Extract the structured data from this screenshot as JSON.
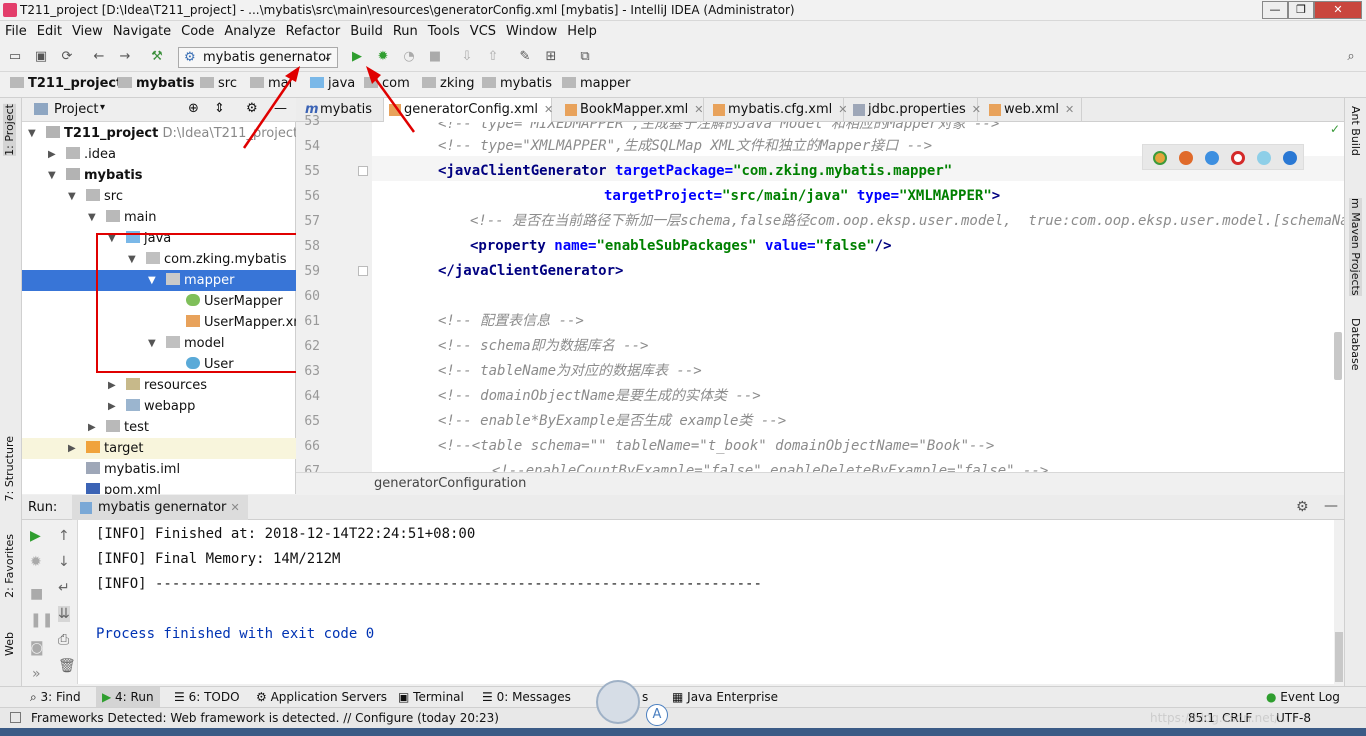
{
  "window": {
    "title": "T211_project [D:\\Idea\\T211_project] - ...\\mybatis\\src\\main\\resources\\generatorConfig.xml [mybatis] - IntelliJ IDEA (Administrator)"
  },
  "menu": [
    "File",
    "Edit",
    "View",
    "Navigate",
    "Code",
    "Analyze",
    "Refactor",
    "Build",
    "Run",
    "Tools",
    "VCS",
    "Window",
    "Help"
  ],
  "toolbar": {
    "run_config": "mybatis genernator"
  },
  "breadcrumbs": [
    "T211_project",
    "mybatis",
    "src",
    "main",
    "java",
    "com",
    "zking",
    "mybatis",
    "mapper"
  ],
  "project_panel": {
    "title": "Project"
  },
  "tree": [
    {
      "label": "T211_project",
      "path": "D:\\Idea\\T211_project",
      "icon": "module-folder-icon"
    },
    {
      "label": ".idea",
      "icon": "folder-icon"
    },
    {
      "label": "mybatis",
      "icon": "module-folder-icon"
    },
    {
      "label": "src",
      "icon": "folder-icon"
    },
    {
      "label": "main",
      "icon": "folder-icon"
    },
    {
      "label": "java",
      "icon": "source-folder-icon"
    },
    {
      "label": "com.zking.mybatis",
      "icon": "package-icon"
    },
    {
      "label": "mapper",
      "icon": "package-icon"
    },
    {
      "label": "UserMapper",
      "icon": "interface-icon"
    },
    {
      "label": "UserMapper.xm",
      "icon": "xml-file-icon"
    },
    {
      "label": "model",
      "icon": "package-icon"
    },
    {
      "label": "User",
      "icon": "class-icon"
    },
    {
      "label": "resources",
      "icon": "resources-folder-icon"
    },
    {
      "label": "webapp",
      "icon": "folder-icon"
    },
    {
      "label": "test",
      "icon": "folder-icon"
    },
    {
      "label": "target",
      "icon": "folder-orange-icon"
    },
    {
      "label": "mybatis.iml",
      "icon": "iml-file-icon"
    },
    {
      "label": "pom.xml",
      "icon": "maven-file-icon"
    }
  ],
  "tabs": [
    "mybatis",
    "generatorConfig.xml",
    "BookMapper.xml",
    "mybatis.cfg.xml",
    "jdbc.properties",
    "web.xml"
  ],
  "line_numbers": [
    "53",
    "54",
    "55",
    "56",
    "57",
    "58",
    "59",
    "60",
    "61",
    "62",
    "63",
    "64",
    "65",
    "66",
    "67"
  ],
  "code": [
    "<!-- type=\"MIXEDMAPPER\",生成基于注解的Java Model 和相应的Mapper对象 -->",
    "<!-- type=\"XMLMAPPER\",生成SQLMap XML文件和独立的Mapper接口 -->",
    "<javaClientGenerator targetPackage=\"com.zking.mybatis.mapper\"",
    "                     targetProject=\"src/main/java\" type=\"XMLMAPPER\">",
    "<!-- 是否在当前路径下新加一层schema,false路径com.oop.eksp.user.model,  true:com.oop.eksp.user.model.[schemaName] -->",
    "<property name=\"enableSubPackages\" value=\"false\"/>",
    "</javaClientGenerator>",
    "",
    "<!-- 配置表信息 -->",
    "<!-- schema即为数据库名 -->",
    "<!-- tableName为对应的数据库表 -->",
    "<!-- domainObjectName是要生成的实体类 -->",
    "<!-- enable*ByExample是否生成 example类 -->",
    "<!--<table schema=\"\" tableName=\"t_book\" domainObjectName=\"Book\"-->",
    "<!--enableCountByExample=\"false\" enableDeleteByExample=\"false\" -->"
  ],
  "code_tokens": {
    "l55_tag": "<javaClientGenerator ",
    "l55_attr": "targetPackage=",
    "l55_val": "\"com.zking.mybatis.mapper\"",
    "l56_attr1": "targetProject=",
    "l56_val1": "\"src/main/java\"",
    "l56_attr2": " type=",
    "l56_val2": "\"XMLMAPPER\"",
    "l56_end": ">",
    "l58_tag": "<property ",
    "l58_attr1": "name=",
    "l58_val1": "\"enableSubPackages\"",
    "l58_attr2": " value=",
    "l58_val2": "\"false\"",
    "l58_end": "/>",
    "l59_tag": "</javaClientGenerator>"
  },
  "editor_breadcrumb": "generatorConfiguration",
  "right_strip": [
    "Ant Build",
    "m Maven Projects",
    "Database"
  ],
  "left_strip": [
    "1: Project",
    "7: Structure",
    "2: Favorites",
    "Web"
  ],
  "run_panel": {
    "label": "Run:",
    "tab": "mybatis genernator"
  },
  "console": [
    "[INFO] Finished at: 2018-12-14T22:24:51+08:00",
    "[INFO] Final Memory: 14M/212M",
    "[INFO] ------------------------------------------------------------------------",
    "",
    "Process finished with exit code 0"
  ],
  "bottom_tabs": [
    "3: Find",
    "4: Run",
    "6: TODO",
    "Application Servers",
    "Terminal",
    "0: Messages",
    "Java Enterprise",
    "Event Log"
  ],
  "bottom_tab_fragment": "s",
  "status": {
    "message": "Frameworks Detected: Web framework is detected. // Configure (today 20:23)",
    "position": "85:1",
    "line_sep": "CRLF",
    "encoding": "UTF-8",
    "watermark": "https://blog.csdn.net/..."
  },
  "colors": {
    "selection": "#3875d7",
    "annotation_red": "#e00000",
    "console_blue": "#0033b3"
  }
}
